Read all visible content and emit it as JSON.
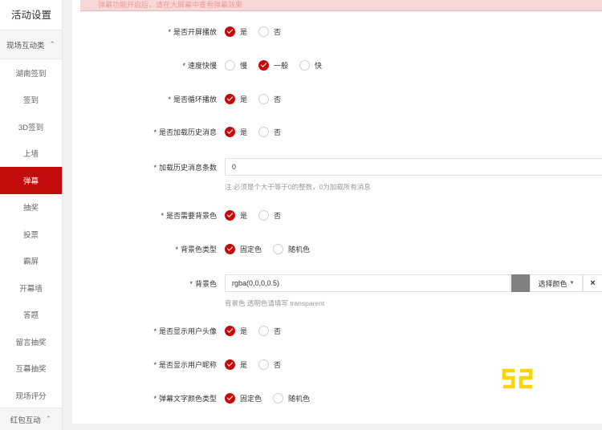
{
  "sidebar": {
    "title": "活动设置",
    "group_top": {
      "label": "现场互动类",
      "chevron": "chevron-down-icon"
    },
    "items": [
      {
        "label": "湖南签到",
        "active": false
      },
      {
        "label": "签到",
        "active": false
      },
      {
        "label": "3D签到",
        "active": false
      },
      {
        "label": "上墙",
        "active": false
      },
      {
        "label": "弹幕",
        "active": true
      },
      {
        "label": "抽奖",
        "active": false
      },
      {
        "label": "投票",
        "active": false
      },
      {
        "label": "霸屏",
        "active": false
      },
      {
        "label": "开幕墙",
        "active": false
      },
      {
        "label": "答题",
        "active": false
      },
      {
        "label": "留言抽奖",
        "active": false
      },
      {
        "label": "互幕抽奖",
        "active": false
      },
      {
        "label": "现场评分",
        "active": false
      }
    ],
    "group_bottom": {
      "label": "红包互动",
      "chevron": "chevron-up-icon"
    }
  },
  "alert": {
    "text": "弹幕功能开启后，请在大屏幕中查看弹幕效果"
  },
  "form": {
    "enable_playback": {
      "label": "是否开屏播放",
      "options": [
        "是",
        "否"
      ],
      "selected": 0
    },
    "speed": {
      "label": "速度快慢",
      "options": [
        "慢",
        "一般",
        "快"
      ],
      "selected": 1
    },
    "loop_playback": {
      "label": "是否循环播放",
      "options": [
        "是",
        "否"
      ],
      "selected": 0
    },
    "load_history": {
      "label": "是否加载历史消息",
      "options": [
        "是",
        "否"
      ],
      "selected": 0
    },
    "history_count": {
      "label": "加载历史消息条数",
      "value": "0",
      "hint": "注:必须是个大于等于0的整数，0为加载所有消息"
    },
    "need_bg": {
      "label": "是否需要背景色",
      "options": [
        "是",
        "否"
      ],
      "selected": 0
    },
    "bg_type": {
      "label": "背景色类型",
      "options": [
        "固定色",
        "随机色"
      ],
      "selected": 0
    },
    "bg_color": {
      "label": "背景色",
      "value": "rgba(0,0,0,0.5)",
      "swatch": "#808080",
      "pick_label": "选择颜色",
      "clear_label": "×",
      "hint": "背景色 透明色请填写 transparent"
    },
    "show_avatar": {
      "label": "是否显示用户头像",
      "options": [
        "是",
        "否"
      ],
      "selected": 0
    },
    "show_nickname": {
      "label": "是否显示用户昵称",
      "options": [
        "是",
        "否"
      ],
      "selected": 0
    },
    "text_color_type": {
      "label": "弹幕文字颜色类型",
      "options": [
        "固定色",
        "随机色"
      ],
      "selected": 0
    }
  },
  "colors": {
    "accent": "#c40b0b",
    "watermark": "#ffd400"
  },
  "watermark": {
    "text": "52"
  }
}
